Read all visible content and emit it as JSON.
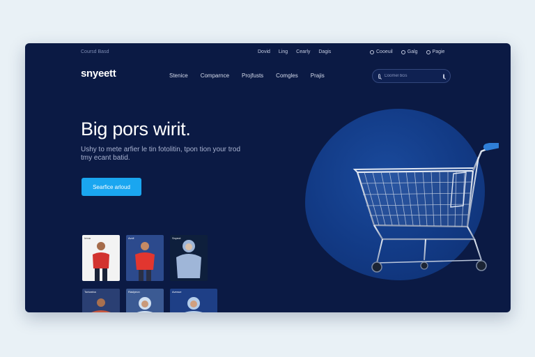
{
  "topbar": {
    "left_text": "Coursd Basd",
    "links": [
      "Dovid",
      "Ling",
      "Cearly",
      "Dagis"
    ],
    "utils": [
      "Cooeuil",
      "Galg",
      "Pagie"
    ]
  },
  "navbar": {
    "logo": "snyeett",
    "links": [
      "Stenice",
      "Comparnce",
      "Projfusts",
      "Comgles",
      "Prajis"
    ],
    "search_placeholder": "Coomel bcis"
  },
  "hero": {
    "title": "Big pors wirit.",
    "subtitle": "Ushy to mete arfier le tin fotolitin, tpon tion your trod tmy ecant batid.",
    "cta_label": "Searfice arloud"
  },
  "thumbnails": [
    {
      "tag": "Imna",
      "bg": "#f3f3f3",
      "shirt": "#d2332f",
      "skin": "#a56b4a"
    },
    {
      "tag": "Avvil",
      "bg": "#2c4a8d",
      "shirt": "#e2362f",
      "skin": "#c58a63"
    },
    {
      "tag": "Snyeot",
      "bg": "#0e1f3c",
      "shirt": "#9fb6d8",
      "skin": "#d9c0aa"
    },
    {
      "tag": "Tortomba",
      "bg": "#2a3f73",
      "shirt": "#c7573f",
      "skin": "#a8704f"
    },
    {
      "tag": "Raslyeon",
      "bg": "#3b5a93",
      "shirt": "#cfe0f2",
      "skin": "#c99a7a"
    },
    {
      "tag": "Avenue",
      "bg": "#1e3f86",
      "shirt": "#b4cdea",
      "skin": "#d0a080"
    }
  ],
  "colors": {
    "background": "#e9f1f6",
    "window": "#0b1a44",
    "accent": "#1aa6f0",
    "blob": "#123a85",
    "cart_handle": "#2f7fd9"
  }
}
